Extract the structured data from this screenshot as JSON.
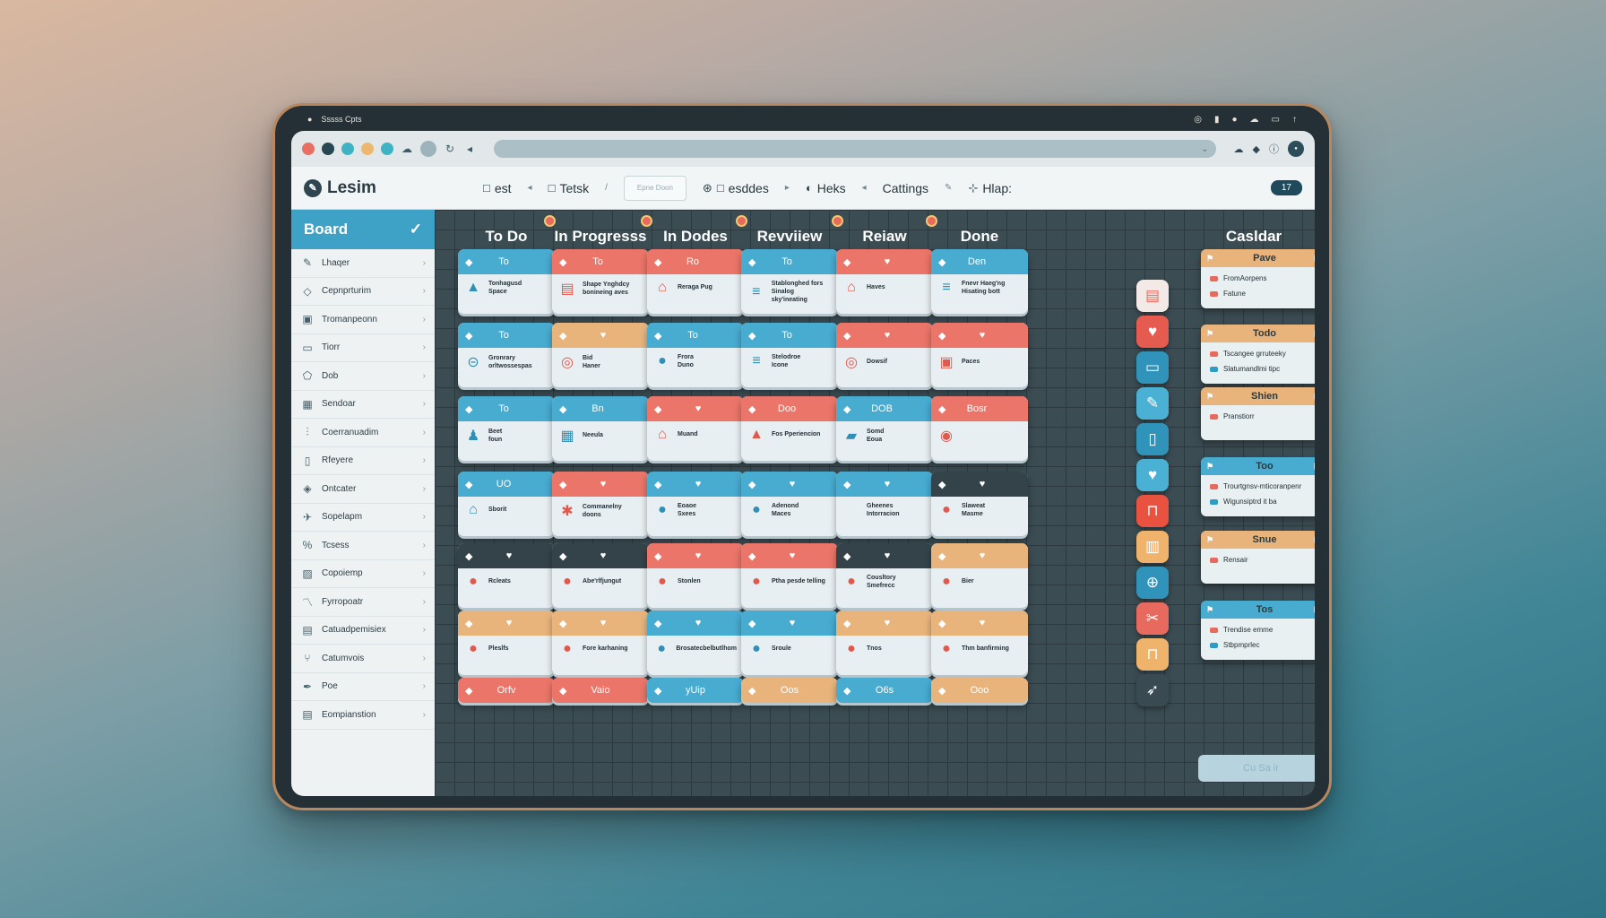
{
  "statusbar": {
    "title": "Sssss Cpts",
    "icons": [
      "wifi-icon",
      "bookmark-icon",
      "user-icon",
      "cloud-icon",
      "battery-icon",
      "up-arrow-icon"
    ]
  },
  "app": {
    "name": "Lesim"
  },
  "menu": [
    {
      "label": "est",
      "icon": "square-icon"
    },
    {
      "label": "Tetsk",
      "icon": "square-icon"
    },
    {
      "label": "esddes",
      "icon": "square-icon"
    },
    {
      "label": "Heks",
      "icon": "circle-icon"
    },
    {
      "label": "Cattings",
      "icon": ""
    },
    {
      "label": "Hlap:",
      "icon": "cursor-icon"
    }
  ],
  "search": {
    "placeholder": "Epne Doon"
  },
  "header_badge": "17",
  "sidebar": {
    "title": "Board",
    "items": [
      {
        "label": "Lhaqer",
        "icon": "pencil-icon"
      },
      {
        "label": "Cepnprturim",
        "icon": "diamond-icon"
      },
      {
        "label": "Tromanpeonn",
        "icon": "image-icon"
      },
      {
        "label": "Tiorr",
        "icon": "window-icon"
      },
      {
        "label": "Dob",
        "icon": "shape-icon"
      },
      {
        "label": "Sendoar",
        "icon": "grid-icon"
      },
      {
        "label": "Coerranuadim",
        "icon": "sliders-icon"
      },
      {
        "label": "Rfeyere",
        "icon": "bar-icon"
      },
      {
        "label": "Ontcater",
        "icon": "gem-icon"
      },
      {
        "label": "Sopelapm",
        "icon": "plane-icon"
      },
      {
        "label": "Tcsess",
        "icon": "percent-icon"
      },
      {
        "label": "Copoiemp",
        "icon": "photo-icon"
      },
      {
        "label": "Fyrropoatr",
        "icon": "chart-icon"
      },
      {
        "label": "Catuadpemisiex",
        "icon": "layers-icon"
      },
      {
        "label": "Catumvois",
        "icon": "branch-icon"
      },
      {
        "label": "Poe",
        "icon": "pen-icon"
      },
      {
        "label": "Eompianstion",
        "icon": "doc-icon"
      }
    ]
  },
  "columns": [
    "To Do",
    "In Progresss",
    "In Dodes",
    "Revviiew",
    "Reiaw",
    "Done"
  ],
  "cards": {
    "rows": [
      [
        {
          "title": "To",
          "color": "blue",
          "body": [
            "Tonhagusd",
            "Space"
          ],
          "icon": "warning-icon"
        },
        {
          "title": "To",
          "color": "coral",
          "body": [
            "Shape Ynghdcy",
            "bonineing aves"
          ],
          "icon": "doc-icon"
        },
        {
          "title": "Ro",
          "color": "coral",
          "body": [
            "Reraga Pug"
          ],
          "icon": "home-icon"
        },
        {
          "title": "To",
          "color": "blue",
          "body": [
            "Stablonghed fors",
            "Sinalog sky'ineating"
          ],
          "icon": "list-icon"
        },
        {
          "title": "",
          "color": "coral",
          "body": [
            "Haves"
          ],
          "icon": "home-icon"
        },
        {
          "title": "Den",
          "color": "blue",
          "body": [
            "Fnevr Haeg'ng",
            "Hisating bott"
          ],
          "icon": "list-icon"
        }
      ],
      [
        {
          "title": "To",
          "color": "blue",
          "body": [
            "Gronrary",
            "orltwossespas"
          ],
          "icon": "lock-icon"
        },
        {
          "title": "",
          "color": "peach",
          "body": [
            "Bid",
            "Haner"
          ],
          "icon": "target-icon"
        },
        {
          "title": "To",
          "color": "blue",
          "body": [
            "Frora",
            "Duno"
          ],
          "icon": "dot-icon"
        },
        {
          "title": "To",
          "color": "blue",
          "body": [
            "Stelodroe",
            "Icone"
          ],
          "icon": "list-icon"
        },
        {
          "title": "",
          "color": "coral",
          "body": [
            "Dowsif"
          ],
          "icon": "target-icon"
        },
        {
          "title": "",
          "color": "coral",
          "body": [
            "Paces"
          ],
          "icon": "image-icon"
        }
      ],
      [
        {
          "title": "To",
          "color": "blue",
          "body": [
            "Beet",
            "foun"
          ],
          "icon": "person-icon"
        },
        {
          "title": "Bn",
          "color": "blue",
          "body": [
            "Neeula"
          ],
          "icon": "grid-icon"
        },
        {
          "title": "",
          "color": "coral",
          "body": [
            "Muand"
          ],
          "icon": "home-icon"
        },
        {
          "title": "Doo",
          "color": "coral",
          "body": [
            "Fos Pperiencion"
          ],
          "icon": "warning-icon"
        },
        {
          "title": "DOB",
          "color": "blue",
          "body": [
            "Somd",
            "Eoua"
          ],
          "icon": "car-icon"
        },
        {
          "title": "Bosr",
          "color": "coral",
          "body": [
            ""
          ],
          "icon": "eye-icon"
        }
      ],
      [
        {
          "title": "UO",
          "color": "blue",
          "body": [
            "Sborit"
          ],
          "icon": "home-icon"
        },
        {
          "title": "",
          "color": "coral",
          "body": [
            "Commanelny doons"
          ],
          "icon": "star-icon"
        },
        {
          "title": "",
          "color": "blue",
          "body": [
            "Eoaoe",
            "Sxees"
          ],
          "icon": "dot-icon"
        },
        {
          "title": "",
          "color": "blue",
          "body": [
            "Adenond",
            "Maces"
          ],
          "icon": "dot-icon"
        },
        {
          "title": "",
          "color": "blue",
          "body": [
            "Gheenes",
            "Intorracion"
          ],
          "icon": ""
        },
        {
          "title": "",
          "color": "dark",
          "body": [
            "Slaweat",
            "Masme"
          ],
          "icon": "dot-icon"
        }
      ],
      [
        {
          "title": "",
          "color": "dark",
          "body": [
            "Rcleats"
          ],
          "icon": "dot-icon"
        },
        {
          "title": "",
          "color": "dark",
          "body": [
            "Abe'rlfjungut"
          ],
          "icon": "dot-icon"
        },
        {
          "title": "",
          "color": "coral",
          "body": [
            "Stonlen"
          ],
          "icon": "dot-icon"
        },
        {
          "title": "",
          "color": "coral",
          "body": [
            "Ptha pesde telling"
          ],
          "icon": "dot-icon"
        },
        {
          "title": "",
          "color": "dark",
          "body": [
            "Cousltory Smefrecc"
          ],
          "icon": "dot-icon"
        },
        {
          "title": "",
          "color": "peach",
          "body": [
            "Bier"
          ],
          "icon": "dot-icon"
        }
      ],
      [
        {
          "title": "",
          "color": "peach",
          "body": [
            "Pleslfs"
          ],
          "icon": "dot-icon"
        },
        {
          "title": "",
          "color": "peach",
          "body": [
            "Fore karhaning"
          ],
          "icon": "dot-icon"
        },
        {
          "title": "",
          "color": "blue",
          "body": [
            "Brosatecbelbutlhom"
          ],
          "icon": "dot-icon"
        },
        {
          "title": "",
          "color": "blue",
          "body": [
            "Sroule"
          ],
          "icon": "dot-icon"
        },
        {
          "title": "",
          "color": "peach",
          "body": [
            "Tnos"
          ],
          "icon": "dot-icon"
        },
        {
          "title": "",
          "color": "peach",
          "body": [
            "Thm banfirming"
          ],
          "icon": "dot-icon"
        }
      ]
    ],
    "footer_row": [
      {
        "title": "Orfv",
        "color": "coral"
      },
      {
        "title": "Vaio",
        "color": "coral"
      },
      {
        "title": "yUip",
        "color": "blue"
      },
      {
        "title": "Oos",
        "color": "peach"
      },
      {
        "title": "O6s",
        "color": "blue"
      },
      {
        "title": "Ooo",
        "color": "peach"
      }
    ]
  },
  "icon_strip": [
    "note-icon",
    "heart-check-icon",
    "window-icon",
    "edit-icon",
    "book-icon",
    "heart-icon",
    "bag-icon",
    "bars-icon",
    "network-icon",
    "cut-icon",
    "frame-icon",
    "bird-icon"
  ],
  "calendar": {
    "title": "Casldar",
    "cards": [
      {
        "title": "Pave",
        "color": "peach",
        "rows": [
          {
            "text": "FromAorpens",
            "c": "#e86a5e"
          },
          {
            "text": "Fatune",
            "c": "#e86a5e"
          }
        ]
      },
      {
        "title": "Todo",
        "color": "peach",
        "rows": [
          {
            "text": "Tscangee grruteeky",
            "c": "#e86a5e"
          },
          {
            "text": "Slatumandlmi tipc",
            "c": "#2f9ac4"
          }
        ]
      },
      {
        "title": "Shien",
        "color": "peach",
        "rows": [
          {
            "text": "Pranstiorr",
            "c": "#e86a5e"
          }
        ]
      },
      {
        "title": "Too",
        "color": "blue",
        "rows": [
          {
            "text": "Trourtgnsv-mticoranpenr",
            "c": "#e86a5e"
          },
          {
            "text": "Wigunsiptrd it ba",
            "c": "#2f9ac4"
          }
        ]
      },
      {
        "title": "Snue",
        "color": "peach",
        "rows": [
          {
            "text": "Rensair",
            "c": "#e86a5e"
          }
        ]
      },
      {
        "title": "Tos",
        "color": "blue",
        "rows": [
          {
            "text": "Trendise emme",
            "c": "#e86a5e"
          },
          {
            "text": "Stbpmprlec",
            "c": "#2f9ac4"
          }
        ]
      }
    ],
    "footer": "Cu Sa ir"
  },
  "colors": {
    "blue": "#48abd0",
    "coral": "#ea7568",
    "peach": "#e8b47c",
    "dark": "#34434a",
    "frame": "#b9875f"
  }
}
